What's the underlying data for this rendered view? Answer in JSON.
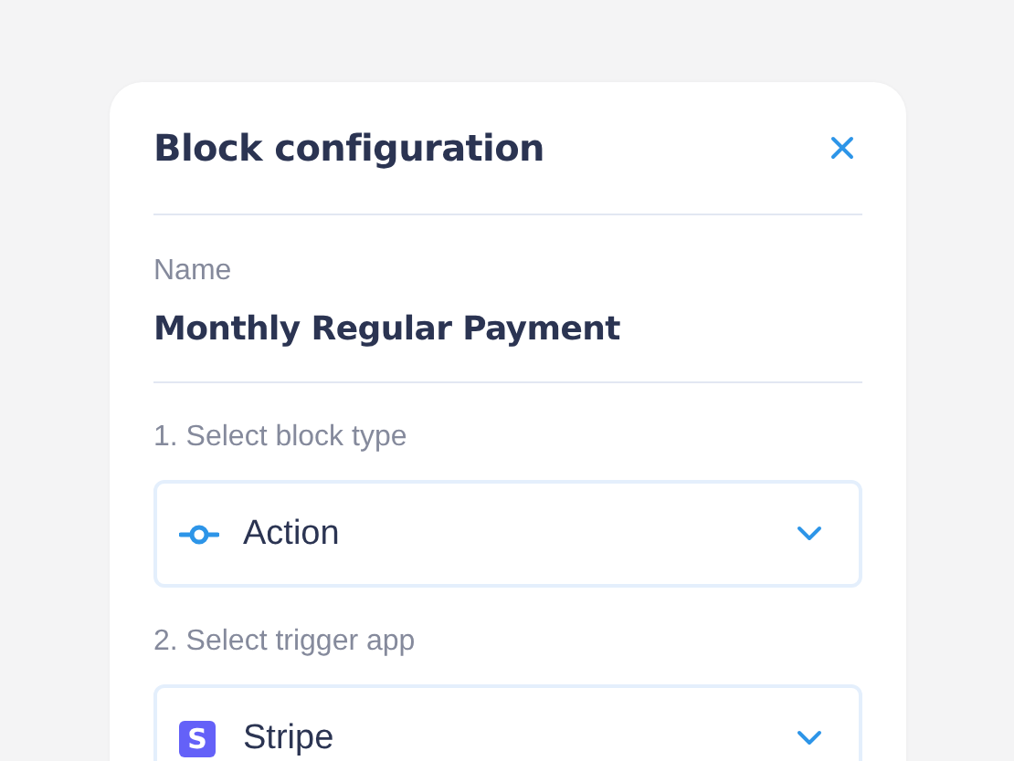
{
  "dialog": {
    "title": "Block configuration"
  },
  "name_field": {
    "label": "Name",
    "value": "Monthly Regular Payment"
  },
  "selects": [
    {
      "label": "1. Select block type",
      "value": "Action",
      "kind": "node"
    },
    {
      "label": "2. Select trigger app",
      "value": "Stripe",
      "kind": "app",
      "badge": "S"
    }
  ]
}
